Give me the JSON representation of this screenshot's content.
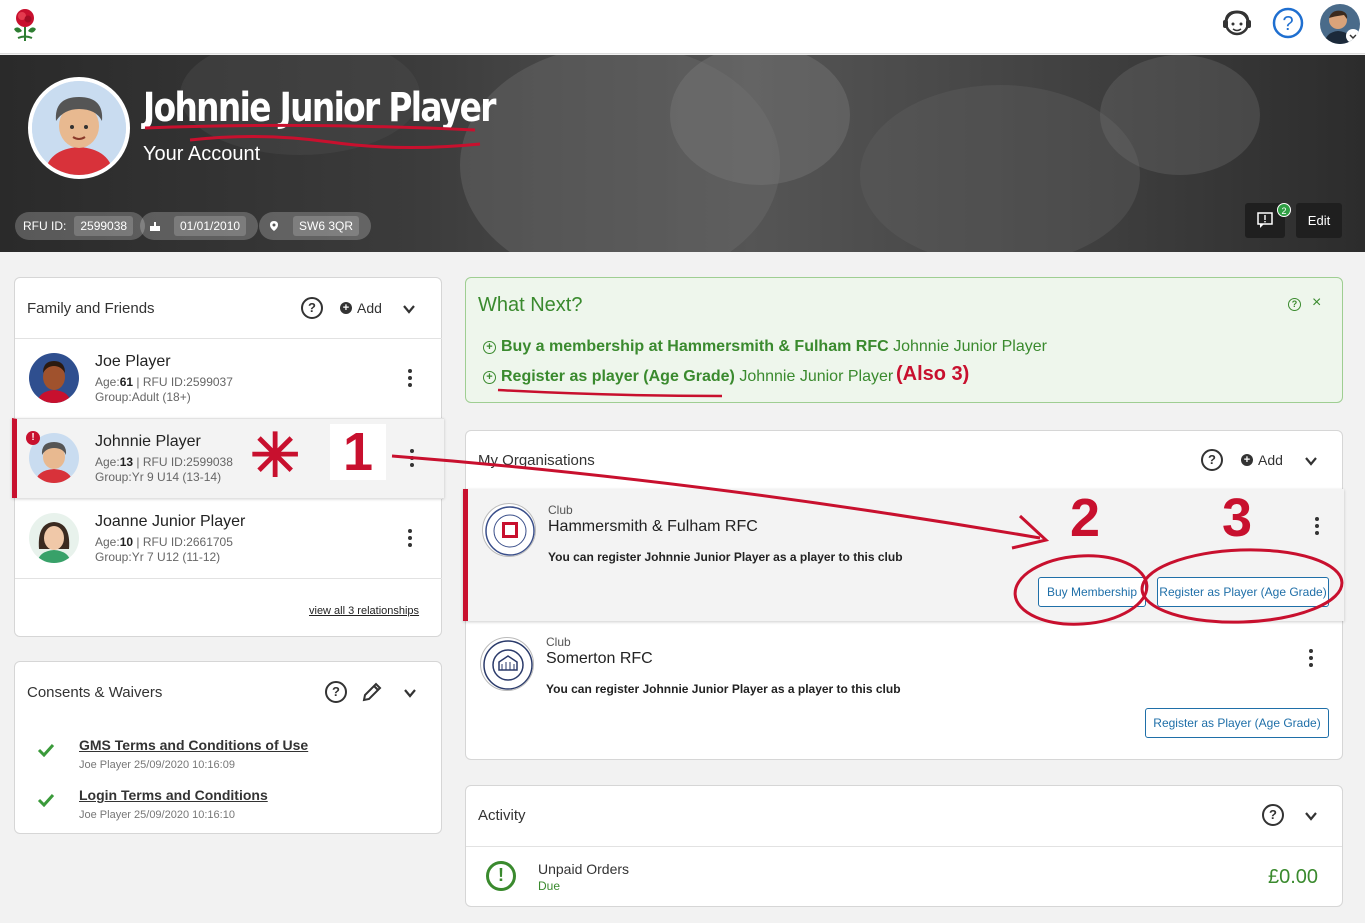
{
  "header": {
    "logo_name": "rose-logo",
    "support_icon": "support-icon",
    "help_icon": "help-icon"
  },
  "profile": {
    "name": "Johnnie Junior Player",
    "subtitle": "Your Account",
    "rfu_label": "RFU ID:",
    "rfu_id": "2599038",
    "dob": "01/01/2010",
    "postcode": "SW6 3QR",
    "message_count": "2",
    "edit_label": "Edit"
  },
  "family": {
    "title": "Family and Friends",
    "help": "?",
    "add_label": "Add",
    "people": [
      {
        "name": "Joe Player",
        "age": "61",
        "rfu_id": "2599037",
        "group": "Adult (18+)"
      },
      {
        "name": "Johnnie Player",
        "age": "13",
        "rfu_id": "2599038",
        "group": "Yr 9 U14 (13-14)",
        "alert": "!"
      },
      {
        "name": "Joanne Junior Player",
        "age": "10",
        "rfu_id": "2661705",
        "group": "Yr 7 U12 (11-12)"
      }
    ],
    "labels": {
      "age": "Age:",
      "rfu": " | RFU ID:",
      "group": "Group:"
    },
    "view_all": "view all 3 relationships"
  },
  "consents": {
    "title": "Consents & Waivers",
    "help": "?",
    "items": [
      {
        "title": "GMS Terms and Conditions of Use",
        "meta": "Joe Player 25/09/2020 10:16:09"
      },
      {
        "title": "Login Terms and Conditions",
        "meta": "Joe Player 25/09/2020 10:16:10"
      }
    ]
  },
  "what_next": {
    "title": "What Next?",
    "help": "?",
    "close": "×",
    "items": [
      {
        "action": "Buy a membership at Hammersmith & Fulham RFC",
        "who": "Johnnie Junior Player"
      },
      {
        "action": "Register as player (Age Grade)",
        "who": "Johnnie Junior Player"
      }
    ]
  },
  "organisations": {
    "title": "My Organisations",
    "help": "?",
    "add_label": "Add",
    "items": [
      {
        "type": "Club",
        "name": "Hammersmith & Fulham RFC",
        "desc": "You can register Johnnie Junior Player as a player to this club",
        "buttons": [
          "Buy Membership",
          "Register as Player (Age Grade)"
        ]
      },
      {
        "type": "Club",
        "name": "Somerton RFC",
        "desc": "You can register Johnnie Junior Player as a player to this club",
        "buttons": [
          "Register as Player (Age Grade)"
        ]
      }
    ]
  },
  "activity": {
    "title": "Activity",
    "help": "?",
    "unpaid_title": "Unpaid Orders",
    "unpaid_status": "Due",
    "unpaid_amount": "£0.00"
  },
  "annotations": {
    "star": "✳",
    "one": "1",
    "two": "2",
    "three": "3",
    "also": "(Also 3)"
  },
  "colors": {
    "brand_red": "#c8102e",
    "green": "#3a8a2e",
    "link_blue": "#1f6fa8"
  }
}
